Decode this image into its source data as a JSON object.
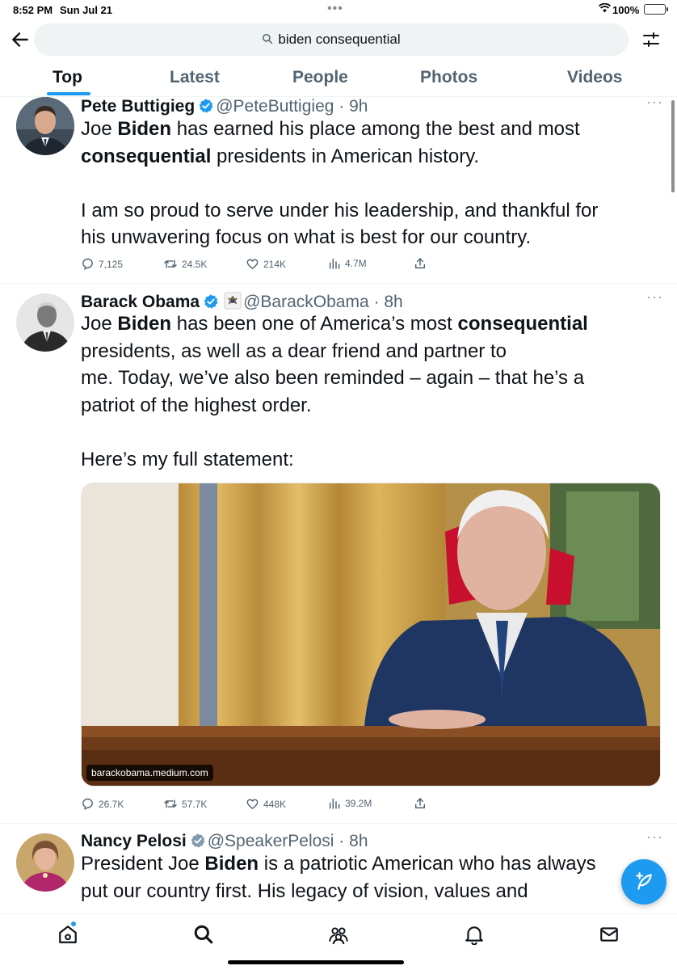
{
  "status_bar": {
    "time": "8:52 PM",
    "date": "Sun Jul 21",
    "dots": "•••",
    "battery": "100%",
    "colors": {
      "battery_fill": "#34c759"
    }
  },
  "search": {
    "query": "biden consequential",
    "icons": {
      "back": "back-arrow-icon",
      "search": "search-icon",
      "filter": "filter-sliders-icon"
    }
  },
  "tabs": [
    {
      "label": "Top",
      "active": true
    },
    {
      "label": "Latest",
      "active": false
    },
    {
      "label": "People",
      "active": false
    },
    {
      "label": "Photos",
      "active": false
    },
    {
      "label": "Videos",
      "active": false
    }
  ],
  "tweets": [
    {
      "name": "Pete Buttigieg",
      "handle": "@PeteButtigieg",
      "time": "9h",
      "more": "···",
      "lines": [
        {
          "pre": "Joe ",
          "bold": "Biden",
          "post": " has earned his place among the best and most"
        },
        {
          "pre": "",
          "bold": "consequential",
          "post": " presidents in American history."
        },
        {
          "pre": "",
          "bold": "",
          "post": ""
        },
        {
          "pre": "",
          "bold": "",
          "post": "I am so proud to serve under his leadership, and thankful for"
        },
        {
          "pre": "",
          "bold": "",
          "post": "his unwavering focus on what is best for our country."
        }
      ],
      "stats": {
        "replies": "7,125",
        "reposts": "24.5K",
        "likes": "214K",
        "views": "4.7M"
      }
    },
    {
      "name": "Barack Obama",
      "handle": "@BarackObama",
      "time": "8h",
      "more": "···",
      "lines": [
        {
          "pre": "Joe ",
          "bold": "Biden",
          "post": " has been one of America’s most ",
          "bold2": "consequential"
        },
        {
          "pre": "",
          "bold": "",
          "post": "presidents, as well as a dear friend and partner to"
        },
        {
          "pre": "",
          "bold": "",
          "post": "me. Today, we’ve also been reminded – again – that he’s a"
        },
        {
          "pre": "",
          "bold": "",
          "post": "patriot of the highest order."
        },
        {
          "pre": "",
          "bold": "",
          "post": ""
        },
        {
          "pre": "",
          "bold": "",
          "post": "Here’s my full statement:"
        }
      ],
      "media_caption": "barackobama.medium.com",
      "stats": {
        "replies": "26.7K",
        "reposts": "57.7K",
        "likes": "448K",
        "views": "39.2M"
      }
    },
    {
      "name": "Nancy Pelosi",
      "handle": "@SpeakerPelosi",
      "time": "8h",
      "more": "···",
      "lines": [
        {
          "pre": "President Joe ",
          "bold": "Biden",
          "post": " is a patriotic American who has always"
        },
        {
          "pre": "",
          "bold": "",
          "post": "put our country first. His legacy of vision, values and"
        }
      ]
    }
  ],
  "colors": {
    "accent": "#1d9bf0",
    "text": "#0f1419",
    "muted": "#536471"
  },
  "bottom_nav": [
    "home-icon",
    "search-icon",
    "communities-icon",
    "notifications-bell-icon",
    "messages-envelope-icon"
  ]
}
